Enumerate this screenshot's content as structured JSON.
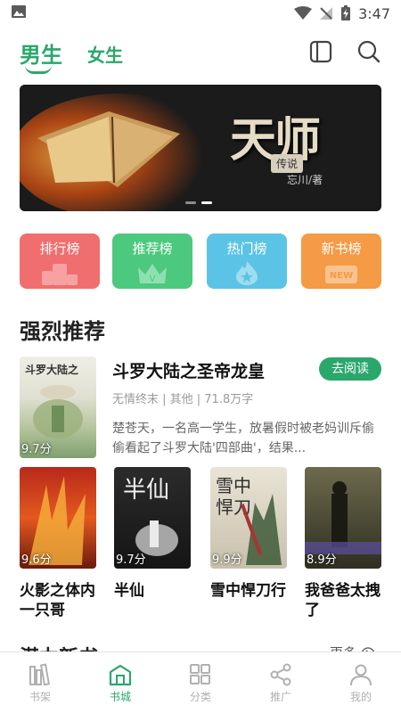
{
  "status_bar": {
    "time": "3:47"
  },
  "header": {
    "tab_male": "男生",
    "tab_female": "女生",
    "icons": [
      "book-icon",
      "search-icon"
    ]
  },
  "banner": {
    "title": "天师",
    "badge": "传说",
    "author": "忘川/著",
    "slide_count": 2,
    "active_slide": 2
  },
  "quick_links": [
    {
      "label": "排行榜",
      "color": "#f06e6e"
    },
    {
      "label": "推荐榜",
      "color": "#4cc97e"
    },
    {
      "label": "热门榜",
      "color": "#5bc4e6"
    },
    {
      "label": "新书榜",
      "color": "#f59a45",
      "tag": "NEW"
    }
  ],
  "section": {
    "title": "强烈推荐",
    "featured": {
      "cover_title": "斗罗大陆之",
      "rating": "9.7分",
      "title": "斗罗大陆之圣帝龙皇",
      "action": "去阅读",
      "meta": "无情终末 | 其他 | 71.8万字",
      "description": "楚苍天，一名高一学生，放暑假时被老妈训斥偷偷看起了斗罗大陆'四部曲'，结果..."
    },
    "books": [
      {
        "name": "火影之体内一只哥",
        "rating": "9.6分",
        "color": "#c0301e"
      },
      {
        "name": "半仙",
        "rating": "9.7分",
        "color": "#1e1e1e"
      },
      {
        "name": "雪中悍刀行",
        "rating": "9.9分",
        "color": "#d9d2c0"
      },
      {
        "name": "我爸爸太拽了",
        "rating": "8.9分",
        "color": "#3a3a2a"
      }
    ]
  },
  "section2": {
    "title": "潜力新书",
    "more": "更多"
  },
  "bottom_nav": [
    {
      "label": "书架",
      "active": false
    },
    {
      "label": "书城",
      "active": true
    },
    {
      "label": "分类",
      "active": false
    },
    {
      "label": "推广",
      "active": false
    },
    {
      "label": "我的",
      "active": false
    }
  ]
}
